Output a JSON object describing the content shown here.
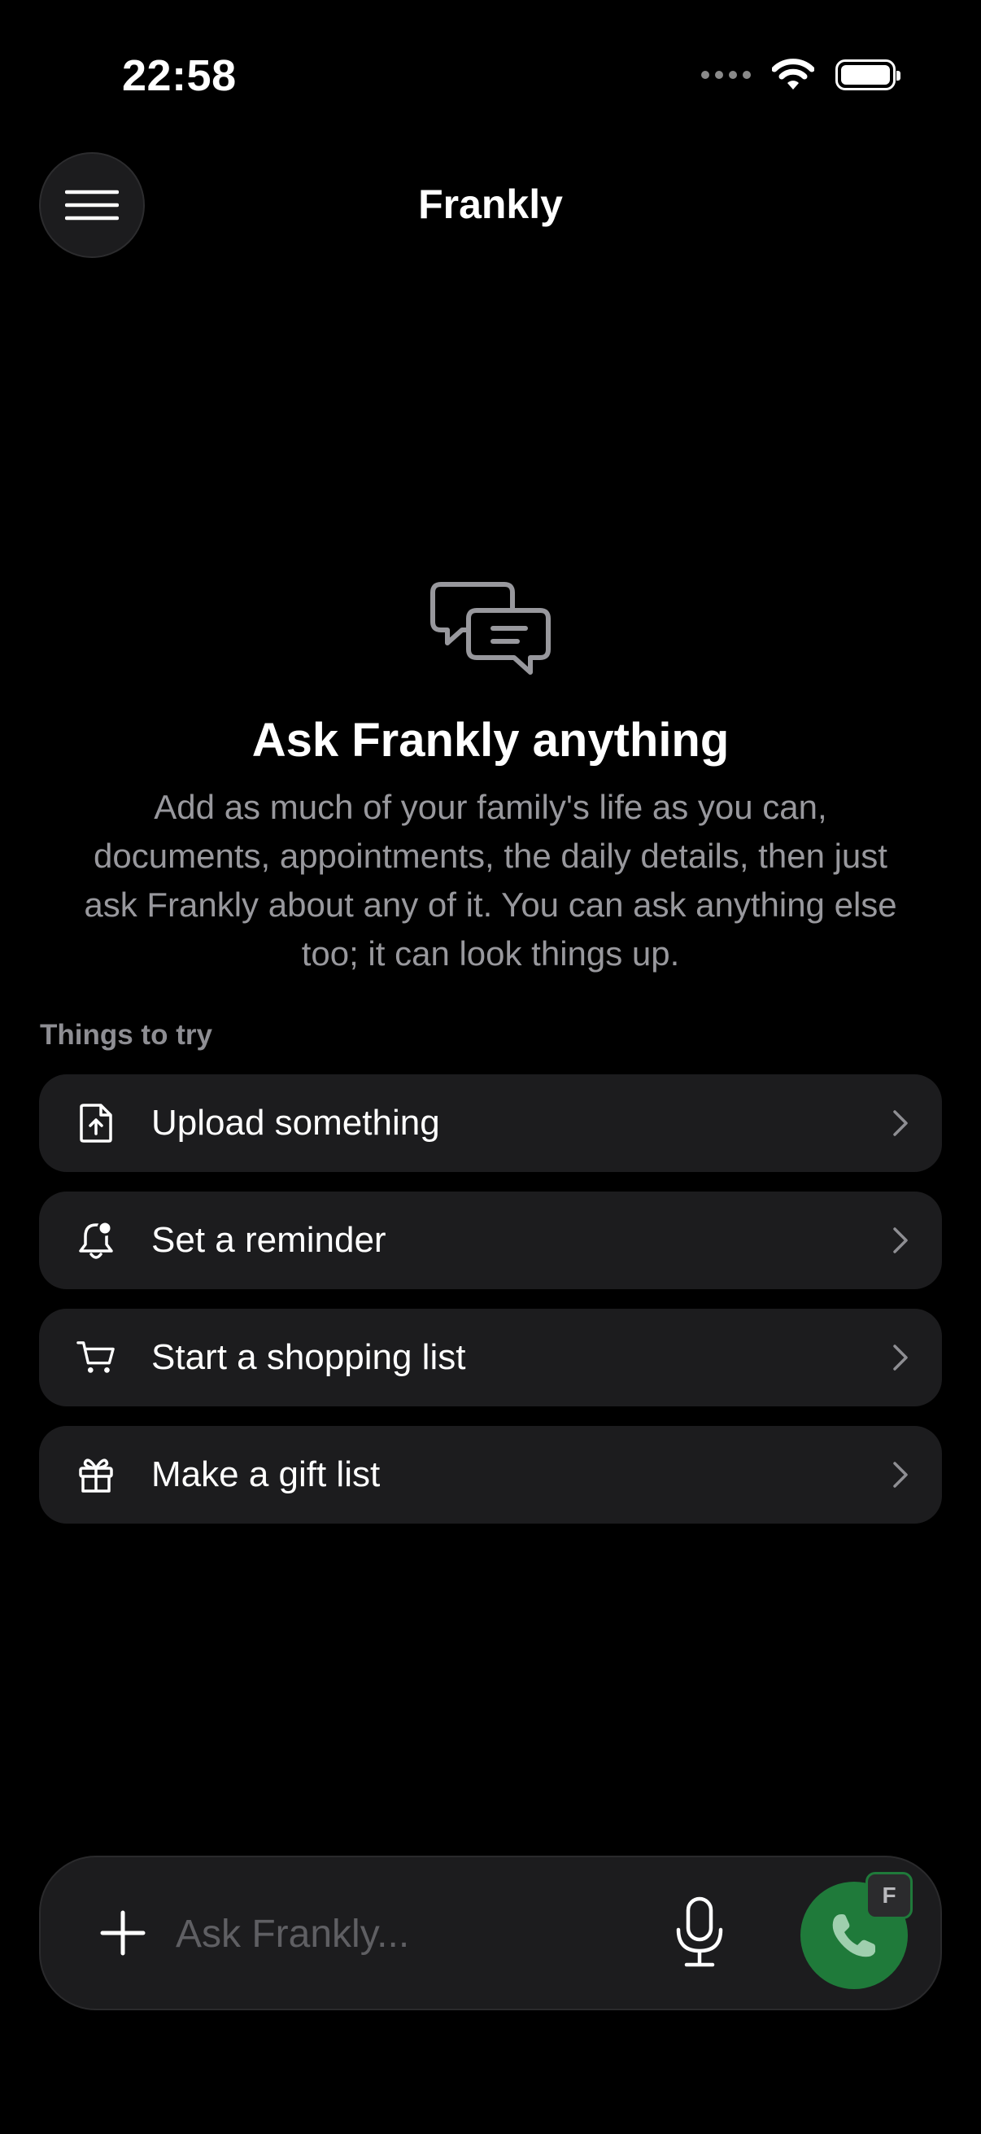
{
  "status_bar": {
    "time": "22:58",
    "icons": [
      "cellular-signal-icon",
      "wifi-icon",
      "battery-icon"
    ]
  },
  "header": {
    "title": "Frankly",
    "menu_icon": "hamburger-menu-icon"
  },
  "empty_state": {
    "icon": "chat-bubbles-icon",
    "title": "Ask Frankly anything",
    "body": "Add as much of your family's life as you can, documents, appointments, the daily details, then just ask Frankly about any of it. You can ask anything else too; it can look things up."
  },
  "suggestions": {
    "section_label": "Things to try",
    "items": [
      {
        "label": "Upload something",
        "icon": "document-upload-icon"
      },
      {
        "label": "Set a reminder",
        "icon": "bell-icon"
      },
      {
        "label": "Start a shopping list",
        "icon": "cart-icon"
      },
      {
        "label": "Make a gift list",
        "icon": "gift-icon"
      }
    ]
  },
  "composer": {
    "placeholder": "Ask Frankly...",
    "value": "",
    "badge": "F"
  },
  "colors": {
    "background": "#000000",
    "surface": "#1c1c1e",
    "call_green": "#1f7a3a",
    "secondary_text": "#98989d"
  }
}
